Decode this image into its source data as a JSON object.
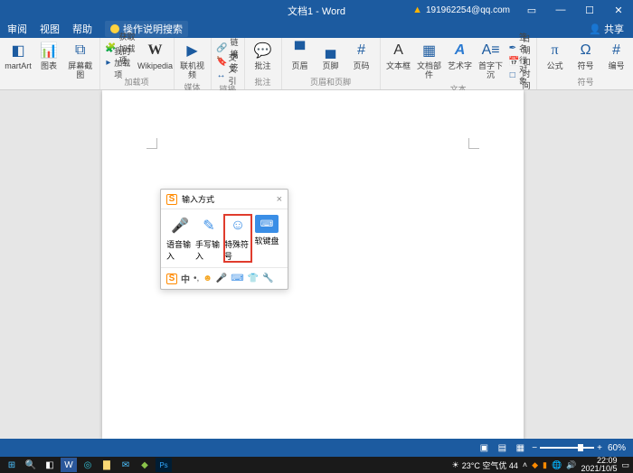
{
  "title": "文档1 - Word",
  "user": "191962254@qq.com",
  "menus": [
    "审阅",
    "视图",
    "帮助"
  ],
  "search_placeholder": "操作说明搜索",
  "share": "共享",
  "ribbon": {
    "groups": {
      "addins": {
        "label": "加载项",
        "smartart": "martArt",
        "chart": "图表",
        "screenshot": "屏幕截图",
        "get_addins": "获取加载项",
        "my_addins": "我的加载项",
        "wikipedia": "Wikipedia"
      },
      "media": {
        "label": "媒体",
        "video": "联机视频"
      },
      "links": {
        "label": "链接",
        "link": "链接",
        "bookmark": "书签",
        "crossref": "交叉引用"
      },
      "comments": {
        "label": "批注",
        "comment": "批注"
      },
      "header": {
        "label": "页眉和页脚",
        "header": "页眉",
        "footer": "页脚",
        "pagenum": "页码"
      },
      "text": {
        "label": "文本",
        "textbox": "文本框",
        "quickparts": "文档部件",
        "wordart": "艺术字",
        "dropcap": "首字下沉",
        "sigline": "签名行",
        "datetime": "日期和时间",
        "object": "对象"
      },
      "symbols": {
        "label": "符号",
        "equation": "公式",
        "symbol": "符号",
        "number": "编号"
      }
    }
  },
  "ime": {
    "title": "输入方式",
    "voice": "语音输入",
    "hand": "手写输入",
    "special": "特殊符号",
    "softkb": "软键盘",
    "foot_cn": "中"
  },
  "status": {
    "page": "",
    "zoom": "60%"
  },
  "tray": {
    "weather": "23°C 空气优 44",
    "time": "22:09",
    "date": "2021/10/5"
  }
}
